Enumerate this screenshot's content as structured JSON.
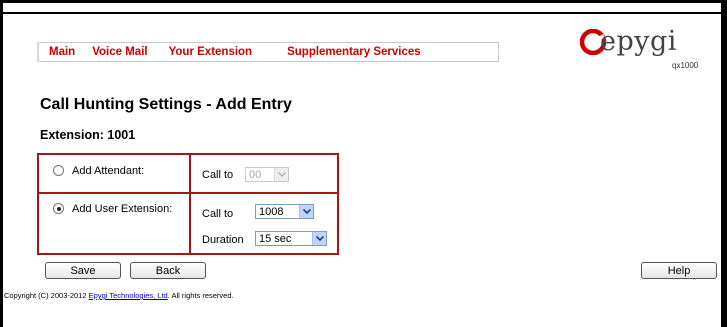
{
  "menu": {
    "items": [
      "Main",
      "Voice Mail",
      "Your Extension",
      "Supplementary Services"
    ]
  },
  "logo": {
    "wordmark": "epygi",
    "model": "qx1000"
  },
  "page": {
    "title": "Call Hunting Settings - Add Entry",
    "extension_label": "Extension: 1001"
  },
  "form": {
    "attendant": {
      "label": "Add Attendant:",
      "selected": false,
      "call_to_label": "Call to",
      "call_to_value": "00",
      "call_to_disabled": true
    },
    "user_extension": {
      "label": "Add User Extension:",
      "selected": true,
      "call_to_label": "Call to",
      "call_to_value": "1008",
      "duration_label": "Duration",
      "duration_value": "15 sec"
    }
  },
  "buttons": {
    "save": "Save",
    "back": "Back",
    "help": "Help"
  },
  "footer": {
    "prefix": "Copyright (C) 2003-2012 ",
    "link": "Epygi Technologies, Ltd",
    "suffix": ". All rights reserved."
  },
  "colors": {
    "menu_text": "#cc0000",
    "table_border": "#a11717",
    "logo_accent": "#cc0000",
    "footer_link": "#0000cc"
  }
}
